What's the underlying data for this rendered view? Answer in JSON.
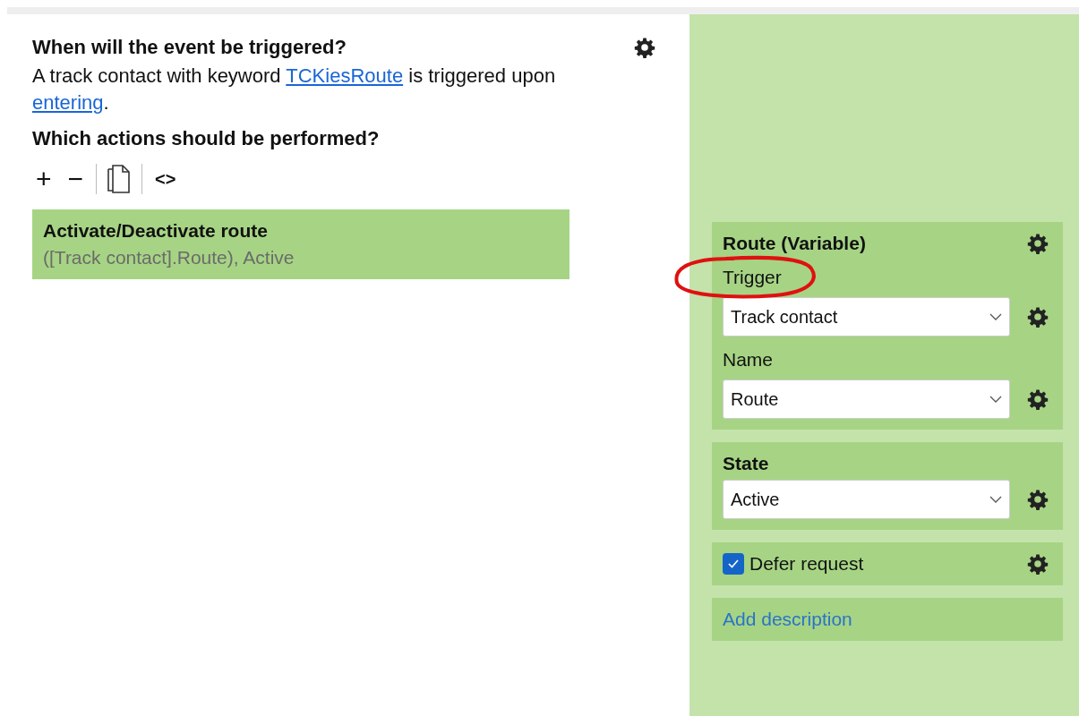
{
  "event": {
    "heading": "When will the event be triggered?",
    "description": [
      {
        "kind": "text",
        "text": "A track contact with keyword "
      },
      {
        "kind": "link",
        "text": "TCKiesRoute"
      },
      {
        "kind": "text",
        "text": " is triggered upon "
      },
      {
        "kind": "link",
        "text": "entering"
      },
      {
        "kind": "text",
        "text": "."
      }
    ]
  },
  "actions": {
    "heading": "Which actions should be performed?",
    "toolbar": [
      {
        "kind": "glyph",
        "text": "+"
      },
      {
        "kind": "glyph",
        "text": "−"
      },
      {
        "kind": "separator"
      },
      {
        "kind": "copy"
      },
      {
        "kind": "separator"
      },
      {
        "kind": "glyph",
        "text": "<>"
      }
    ],
    "items": [
      {
        "title": "Activate/Deactivate route",
        "detail": "([Track contact].Route), Active",
        "selected": true
      }
    ]
  },
  "properties": [
    {
      "kind": "group",
      "title": "Route (Variable)",
      "fields": [
        {
          "label": "Trigger",
          "value": "Track contact"
        },
        {
          "label": "Name",
          "value": "Route"
        }
      ]
    },
    {
      "kind": "dropdown",
      "title": "State",
      "value": "Active"
    },
    {
      "kind": "checkbox",
      "label": "Defer request",
      "checked": true
    },
    {
      "kind": "link",
      "label": "Add description"
    }
  ]
}
